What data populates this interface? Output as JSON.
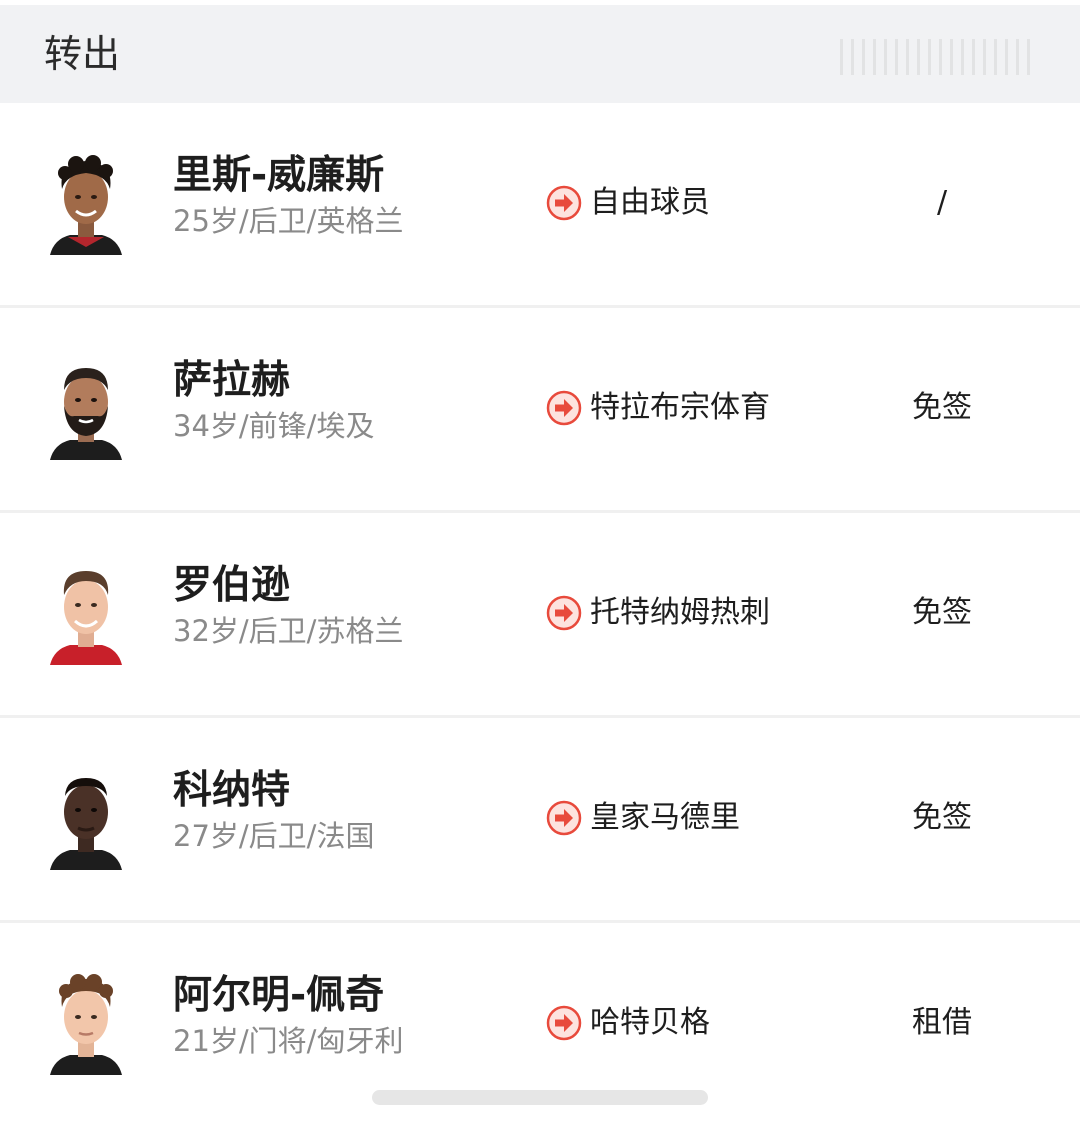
{
  "header": {
    "title": "转出"
  },
  "icons": {
    "transfer": "arrow-right-circle-icon"
  },
  "colors": {
    "accent": "#e84a3c",
    "header_bg": "#f1f2f4",
    "meta_text": "#8a8a8a"
  },
  "transfers": [
    {
      "name": "里斯-威廉斯",
      "meta": "25岁/后卫/英格兰",
      "destination": "自由球员",
      "fee": "/"
    },
    {
      "name": "萨拉赫",
      "meta": "34岁/前锋/埃及",
      "destination": "特拉布宗体育",
      "fee": "免签"
    },
    {
      "name": "罗伯逊",
      "meta": "32岁/后卫/苏格兰",
      "destination": "托特纳姆热刺",
      "fee": "免签"
    },
    {
      "name": "科纳特",
      "meta": "27岁/后卫/法国",
      "destination": "皇家马德里",
      "fee": "免签"
    },
    {
      "name": "阿尔明-佩奇",
      "meta": "21岁/门将/匈牙利",
      "destination": "哈特贝格",
      "fee": "租借"
    }
  ]
}
